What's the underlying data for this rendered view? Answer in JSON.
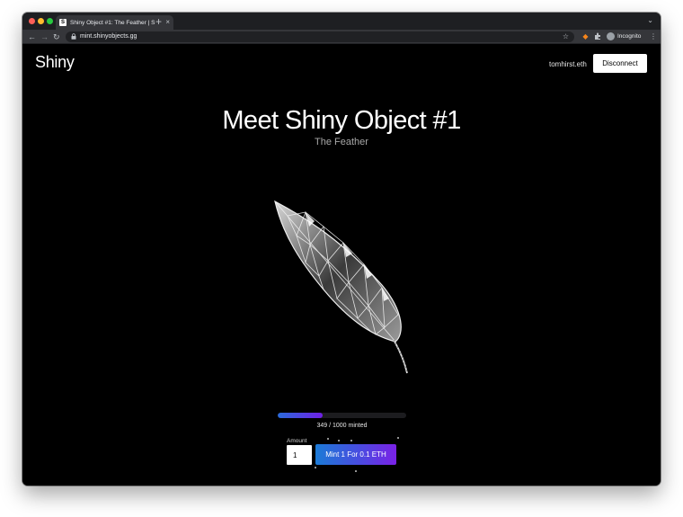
{
  "browser": {
    "tab_title": "Shiny Object #1: The Feather | S",
    "tab_favicon": "S",
    "url": "mint.shinyobjects.gg",
    "profile_label": "Incognito",
    "icons": [
      "back-arrow",
      "forward-arrow",
      "reload",
      "lock",
      "star",
      "metamask-fox",
      "extensions-puzzle",
      "incognito-avatar",
      "menu-dots"
    ]
  },
  "header": {
    "logo": "Shiny",
    "account": "tomhirst.eth",
    "disconnect_label": "Disconnect"
  },
  "hero": {
    "title": "Meet Shiny Object #1",
    "subtitle": "The Feather"
  },
  "mint": {
    "minted_count": 349,
    "total_supply": 1000,
    "progress_fraction": 0.349,
    "progress_label": "349 / 1000 minted",
    "amount_label": "Amount",
    "amount_value": "1",
    "button_label": "Mint 1 For 0.1 ETH"
  },
  "colors": {
    "page_bg": "#000000",
    "gradient_start": "#1b7ad6",
    "gradient_end": "#7a21e6"
  }
}
